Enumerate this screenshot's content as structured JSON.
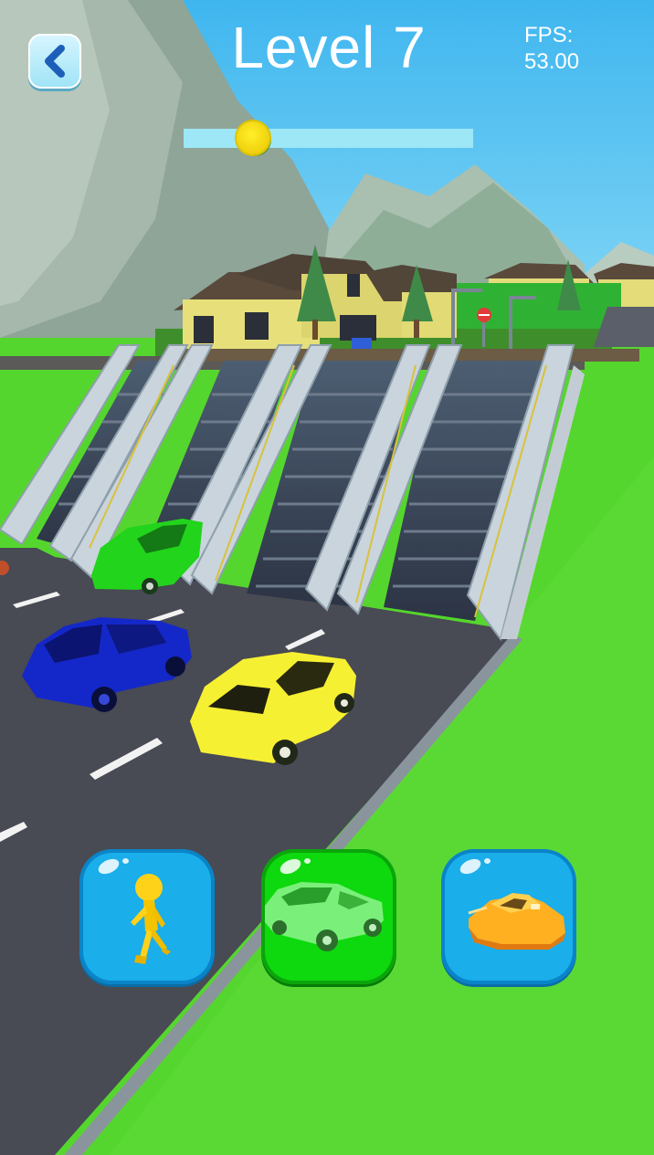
{
  "hud": {
    "level_label": "Level 7",
    "fps_label": "FPS:",
    "fps_value": "53.00",
    "progress": 0.24
  },
  "colors": {
    "sky": "#5ec8f2",
    "grass": "#4fd42a",
    "road": "#494b55",
    "car_green": "#22d41c",
    "car_blue": "#1222c8",
    "car_yellow": "#f6f032",
    "button_blue": "#1aaeea",
    "button_green": "#0ed80e"
  },
  "icons": {
    "back": "chevron-left-icon",
    "walk": "runner-icon",
    "car": "car-icon",
    "boat": "boat-icon"
  },
  "mode_buttons": [
    {
      "mode": "walk",
      "selected": false
    },
    {
      "mode": "car",
      "selected": true
    },
    {
      "mode": "boat",
      "selected": false
    }
  ]
}
